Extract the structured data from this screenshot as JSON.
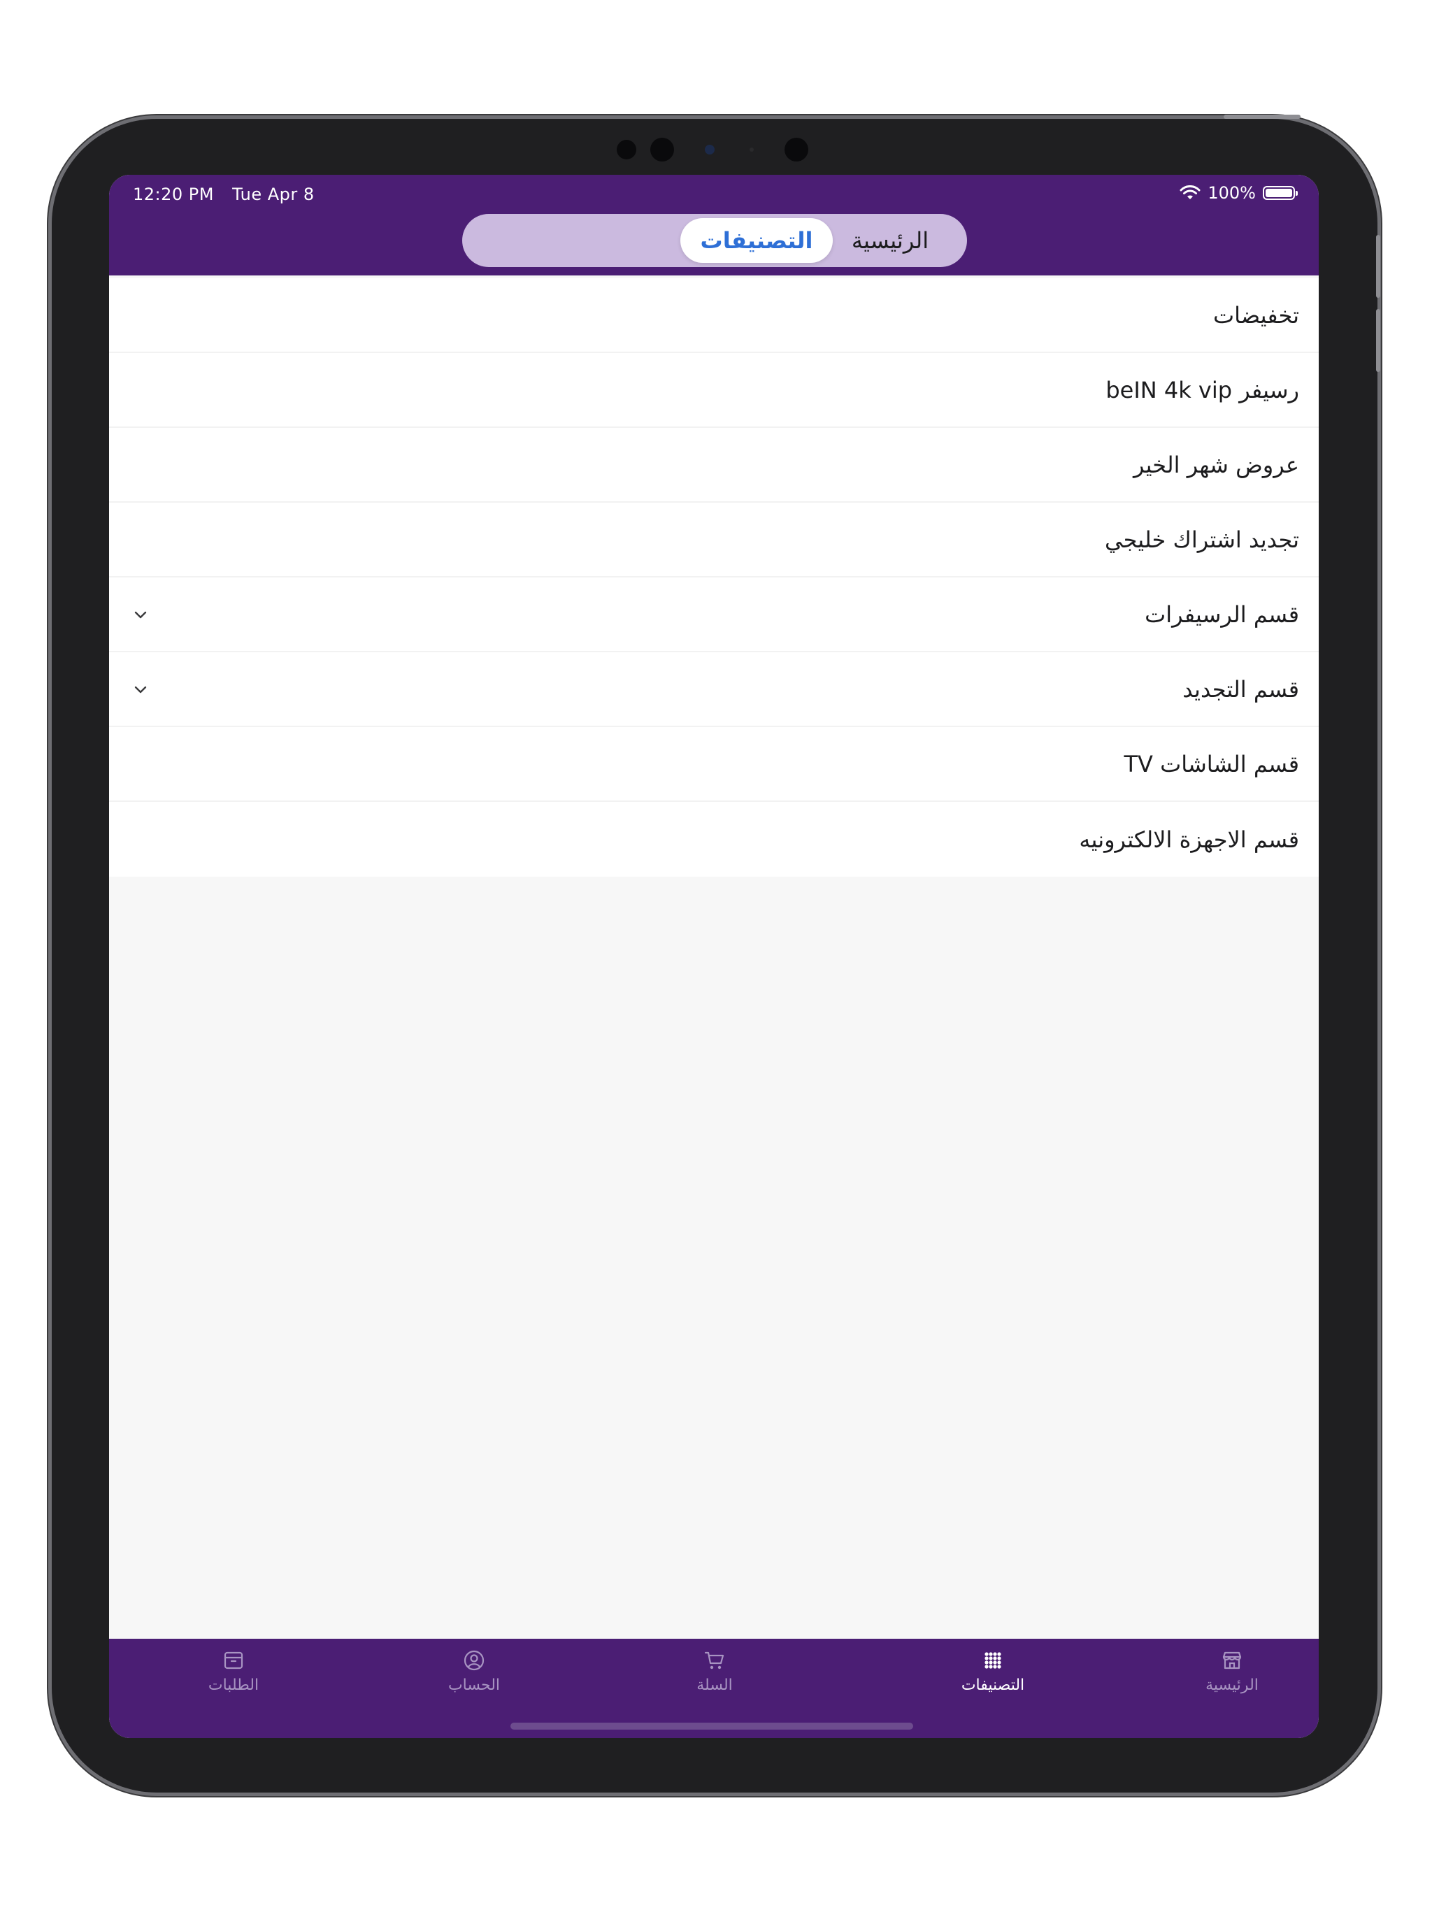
{
  "status_bar": {
    "time": "12:20 PM",
    "date": "Tue Apr 8",
    "battery_percent": "100%",
    "battery_level": 1.0
  },
  "header": {
    "segments": {
      "home": "الرئيسية",
      "categories": "التصنيفات"
    },
    "selected_segment": "categories"
  },
  "categories": [
    {
      "label": "تخفيضات",
      "expandable": false
    },
    {
      "label": "رسيفر beIN 4k vip",
      "expandable": false
    },
    {
      "label": "عروض شهر الخير",
      "expandable": false
    },
    {
      "label": "تجديد اشتراك خليجي",
      "expandable": false
    },
    {
      "label": "قسم الرسيفرات",
      "expandable": true
    },
    {
      "label": "قسم التجديد",
      "expandable": true
    },
    {
      "label": "قسم الشاشات TV",
      "expandable": false
    },
    {
      "label": "قسم الاجهزة الالكترونيه",
      "expandable": false
    }
  ],
  "tab_bar": {
    "items": [
      {
        "label": "الرئيسية",
        "icon": "store-icon",
        "active": false
      },
      {
        "label": "التصنيفات",
        "icon": "grid-dots-icon",
        "active": true
      },
      {
        "label": "السلة",
        "icon": "cart-icon",
        "active": false
      },
      {
        "label": "الحساب",
        "icon": "user-circle-icon",
        "active": false
      },
      {
        "label": "الطلبات",
        "icon": "box-icon",
        "active": false
      }
    ]
  },
  "colors": {
    "brand_purple": "#4b1e74",
    "segment_bg": "#cbbadf",
    "segment_active_text": "#2e6fd6",
    "tab_inactive": "#a894c2"
  }
}
